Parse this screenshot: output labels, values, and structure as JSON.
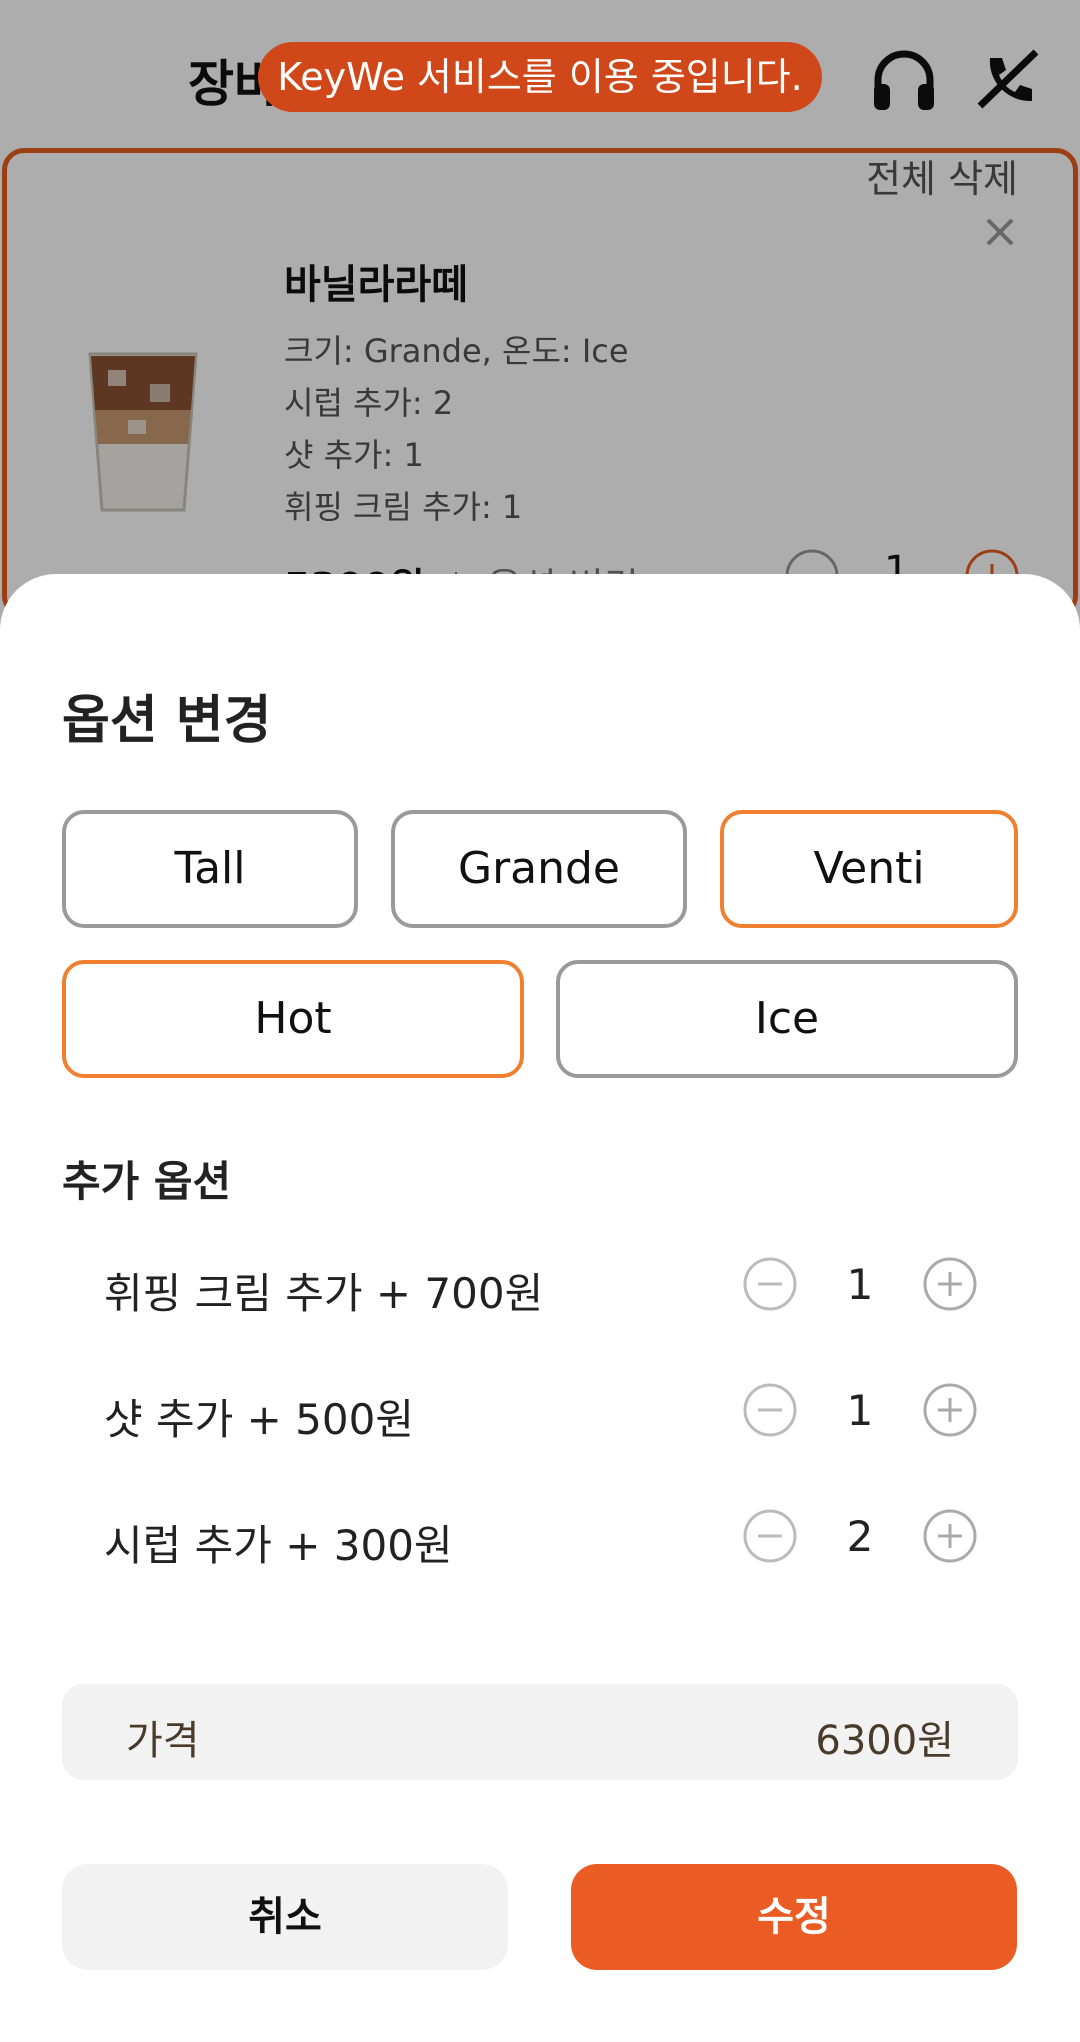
{
  "header": {
    "title": "장바구니",
    "headset_icon": "headset-icon",
    "call_end_icon": "call-end-icon"
  },
  "toast": {
    "text": "KeyWe 서비스를 이용 중입니다."
  },
  "cart": {
    "delete_all_label": "전체 삭제",
    "item": {
      "name": "바닐라라떼",
      "options": [
        "크기: Grande, 온도: Ice",
        "시럽 추가: 2",
        "샷 추가: 1",
        "휘핑 크림 추가: 1"
      ],
      "price": "5300원",
      "change_option_label": "옵션 변경",
      "quantity": "1",
      "image_icon": "iced-latte-image"
    }
  },
  "sheet": {
    "title": "옵션 변경",
    "sizes": [
      {
        "label": "Tall",
        "selected": false
      },
      {
        "label": "Grande",
        "selected": false
      },
      {
        "label": "Venti",
        "selected": true
      }
    ],
    "temperatures": [
      {
        "label": "Hot",
        "selected": true
      },
      {
        "label": "Ice",
        "selected": false
      }
    ],
    "addon_section_title": "추가 옵션",
    "addons": [
      {
        "label": "휘핑 크림 추가 + 700원",
        "quantity": "1"
      },
      {
        "label": "샷 추가 + 500원",
        "quantity": "1"
      },
      {
        "label": "시럽 추가 + 300원",
        "quantity": "2"
      }
    ],
    "price_label": "가격",
    "price_value": "6300원",
    "cancel_label": "취소",
    "confirm_label": "수정"
  },
  "colors": {
    "accent": "#eb5c24",
    "selected_border": "#f08030",
    "unselected_border": "#9a9a9a",
    "toast_bg": "#d0481a"
  }
}
